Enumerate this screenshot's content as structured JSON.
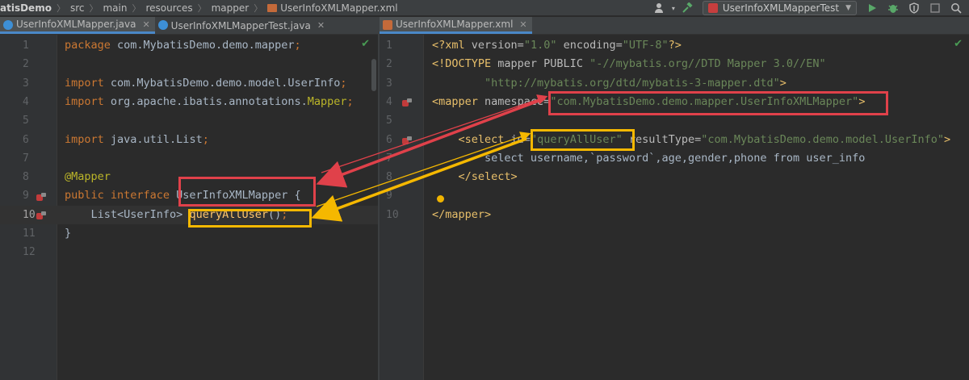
{
  "breadcrumb": [
    "atisDemo",
    "src",
    "main",
    "resources",
    "mapper",
    "UserInfoXMLMapper.xml"
  ],
  "toolbar": {
    "run_config": "UserInfoXMLMapperTest"
  },
  "left_tabs": [
    {
      "label": "UserInfoXMLMapper.java",
      "active": true,
      "icon_color": "#3d8fd6"
    },
    {
      "label": "UserInfoXMLMapperTest.java",
      "active": false,
      "icon_color": "#3d8fd6"
    }
  ],
  "right_tabs": [
    {
      "label": "UserInfoXMLMapper.xml",
      "active": true,
      "icon_color": "#c46a3a"
    }
  ],
  "left_editor": {
    "line_numbers": [
      "1",
      "2",
      "3",
      "4",
      "5",
      "6",
      "7",
      "8",
      "9",
      "10",
      "11",
      "12"
    ],
    "lines": [
      [
        [
          "kw",
          "package "
        ],
        [
          "plain",
          "com.MybatisDemo.demo.mapper"
        ],
        [
          "kw",
          ";"
        ]
      ],
      [],
      [
        [
          "kw",
          "import "
        ],
        [
          "plain",
          "com.MybatisDemo.demo.model.UserInfo"
        ],
        [
          "kw",
          ";"
        ]
      ],
      [
        [
          "kw",
          "import "
        ],
        [
          "plain",
          "org.apache.ibatis.annotations."
        ],
        [
          "ann",
          "Mapper"
        ],
        [
          "kw",
          ";"
        ]
      ],
      [],
      [
        [
          "kw",
          "import "
        ],
        [
          "plain",
          "java.util.List"
        ],
        [
          "kw",
          ";"
        ]
      ],
      [],
      [
        [
          "ann",
          "@Mapper"
        ]
      ],
      [
        [
          "kw",
          "public interface "
        ],
        [
          "plain",
          "UserInfoXMLMapper {"
        ]
      ],
      [
        [
          "plain",
          "    List<UserInfo> "
        ],
        [
          "fn",
          "queryAllUser"
        ],
        [
          "plain",
          "()"
        ],
        [
          "kw",
          ";"
        ]
      ],
      [
        [
          "plain",
          "}"
        ]
      ],
      []
    ]
  },
  "right_editor": {
    "line_numbers": [
      "1",
      "2",
      "3",
      "4",
      "5",
      "6",
      "7",
      "8",
      "9",
      "10"
    ],
    "lines": [
      [
        [
          "tag",
          "<?xml "
        ],
        [
          "attr",
          "version="
        ],
        [
          "str",
          "\"1.0\" "
        ],
        [
          "attr",
          "encoding="
        ],
        [
          "str",
          "\"UTF-8\""
        ],
        [
          "tag",
          "?>"
        ]
      ],
      [
        [
          "tag",
          "<!DOCTYPE "
        ],
        [
          "attr",
          "mapper PUBLIC "
        ],
        [
          "str",
          "\"-//mybatis.org//DTD Mapper 3.0//EN\""
        ]
      ],
      [
        [
          "str",
          "        \"http://mybatis.org/dtd/mybatis-3-mapper.dtd\""
        ],
        [
          "tag",
          ">"
        ]
      ],
      [
        [
          "tag",
          "<mapper "
        ],
        [
          "attr",
          "namespace="
        ],
        [
          "str",
          "\"com.MybatisDemo.demo.mapper.UserInfoXMLMapper\""
        ],
        [
          "tag",
          ">"
        ]
      ],
      [],
      [
        [
          "tag",
          "    <select "
        ],
        [
          "attr",
          "id="
        ],
        [
          "str",
          "\"queryAllUser\" "
        ],
        [
          "attr",
          "resultType="
        ],
        [
          "str",
          "\"com.MybatisDemo.demo.model.UserInfo\""
        ],
        [
          "tag",
          ">"
        ]
      ],
      [
        [
          "plain",
          "        select username,`password`,age,gender,phone from user_info"
        ]
      ],
      [
        [
          "tag",
          "    </select>"
        ]
      ],
      [],
      [
        [
          "tag",
          "</mapper>"
        ]
      ]
    ]
  },
  "colors": {
    "highlight_red": "#e0414a",
    "highlight_yellow": "#f5b800",
    "check_green": "#499c54"
  },
  "icons": [
    "search-icon",
    "user-icon",
    "hammer-icon",
    "run-icon",
    "debug-icon",
    "coverage-icon",
    "stop-icon",
    "check-icon",
    "mapper-gutter-icon",
    "lightbulb-icon"
  ]
}
